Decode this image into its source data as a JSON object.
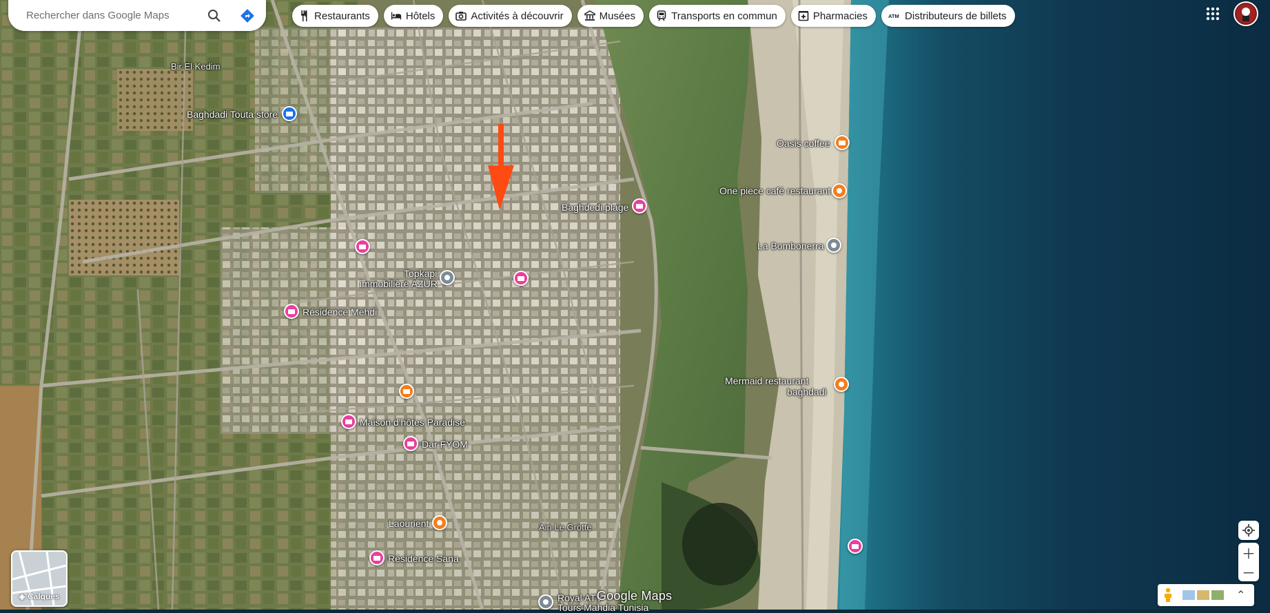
{
  "search": {
    "placeholder": "Rechercher dans Google Maps"
  },
  "chips": [
    {
      "label": "Restaurants",
      "icon": "fork-knife-icon"
    },
    {
      "label": "Hôtels",
      "icon": "bed-icon"
    },
    {
      "label": "Activités à découvrir",
      "icon": "camera-icon"
    },
    {
      "label": "Musées",
      "icon": "museum-icon"
    },
    {
      "label": "Transports en commun",
      "icon": "train-icon"
    },
    {
      "label": "Pharmacies",
      "icon": "pharmacy-icon"
    },
    {
      "label": "Distributeurs de billets",
      "icon": "atm-icon"
    }
  ],
  "places": [
    {
      "label": "Bir El Kedim",
      "type": "area"
    },
    {
      "label": "Baghdadi Touta store",
      "type": "shop"
    },
    {
      "label": "Oasis coffee",
      "type": "food"
    },
    {
      "label": "One piece café restaurant",
      "type": "food"
    },
    {
      "label": "Baghdedi plage",
      "type": "hotel"
    },
    {
      "label": "La Bombonerra",
      "type": "gray"
    },
    {
      "label": "Topkapi",
      "type": "gray"
    },
    {
      "label": "immobilière AZUR",
      "type": "text"
    },
    {
      "label": "Résidence Mehdi",
      "type": "hotel"
    },
    {
      "label": "Mermaid restaurant",
      "type": "food"
    },
    {
      "label": "baghdadi",
      "type": "text"
    },
    {
      "label": "Maison d'hôtes Paradise",
      "type": "hotel"
    },
    {
      "label": "Dar FYOM",
      "type": "hotel"
    },
    {
      "label": "Laourient",
      "type": "food"
    },
    {
      "label": "Ain Le Grotte",
      "type": "area"
    },
    {
      "label": "Résidence Sana",
      "type": "hotel"
    },
    {
      "label": "Royal ATV",
      "type": "gray"
    },
    {
      "label": "Tours Mahdia Tunisia",
      "type": "text"
    }
  ],
  "layers": {
    "label": "Calques"
  },
  "watermark": "Google Maps",
  "colors": {
    "hotel": "#e8409c",
    "food": "#f57c1c",
    "poi": "#7d8a96",
    "shop": "#1a73e8",
    "arrow": "#ff4a14"
  }
}
